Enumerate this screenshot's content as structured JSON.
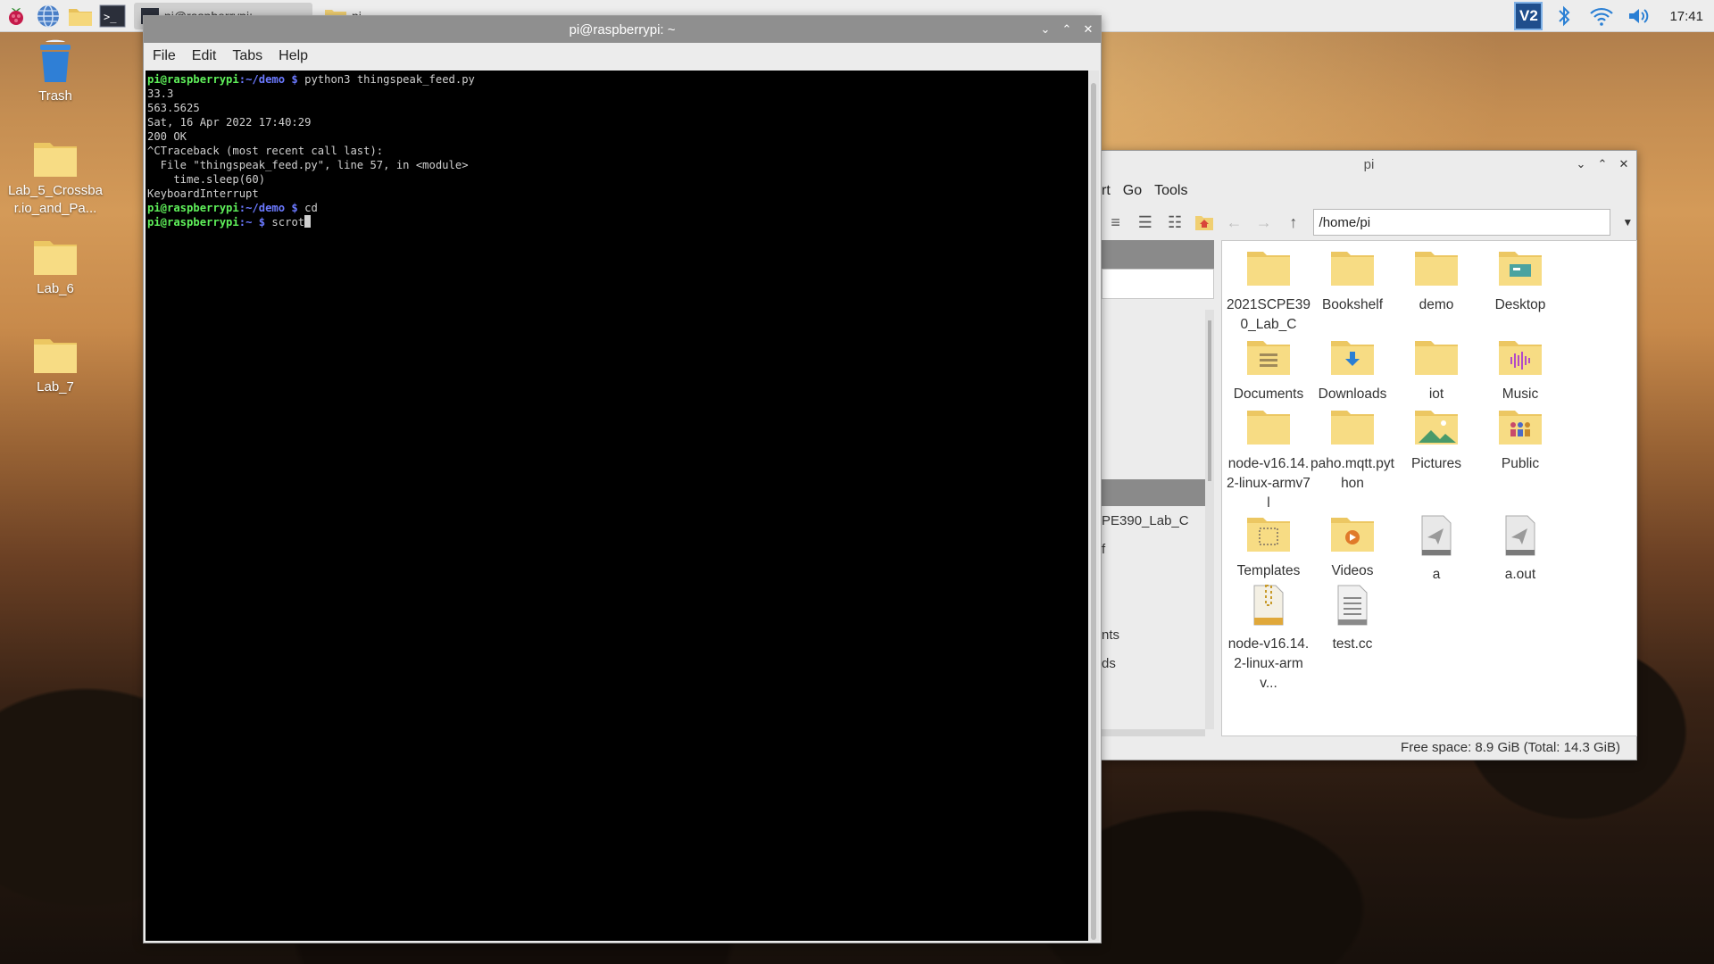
{
  "taskbar": {
    "tasks": [
      {
        "label": "pi@raspberrypi: ~",
        "active": true
      },
      {
        "label": "pi",
        "active": false
      }
    ],
    "tray": {
      "vnc": "V2",
      "clock": "17:41"
    }
  },
  "desktop": {
    "icons": [
      {
        "label": "Trash"
      },
      {
        "label": "Lab_5_Crossbar.io_and_Pa..."
      },
      {
        "label": "Lab_6"
      },
      {
        "label": "Lab_7"
      }
    ]
  },
  "terminal": {
    "title": "pi@raspberrypi: ~",
    "menu": [
      "File",
      "Edit",
      "Tabs",
      "Help"
    ],
    "prompt_user": "pi@raspberrypi",
    "lines": {
      "l1_path": ":~/demo $",
      "l1_cmd": " python3 thingspeak_feed.py",
      "l2": "33.3",
      "l3": "563.5625",
      "l4": "Sat, 16 Apr 2022 17:40:29",
      "l5": "200 OK",
      "l6": "^CTraceback (most recent call last):",
      "l7": "  File \"thingspeak_feed.py\", line 57, in <module>",
      "l8": "    time.sleep(60)",
      "l9": "KeyboardInterrupt",
      "l10_path": ":~/demo $",
      "l10_cmd": " cd",
      "l11_path": ":~ $",
      "l11_cmd": " scrot"
    }
  },
  "filemanager": {
    "title": "pi",
    "menu": [
      "rt",
      "Go",
      "Tools"
    ],
    "path": "/home/pi",
    "side_items": [
      "PE390_Lab_C",
      "f",
      "nts",
      "ds"
    ],
    "items": [
      {
        "label": "2021SCPE390_Lab_C",
        "icon": "folder-icon"
      },
      {
        "label": "Bookshelf",
        "icon": "folder-icon"
      },
      {
        "label": "demo",
        "icon": "folder-icon"
      },
      {
        "label": "Desktop",
        "icon": "desktop-folder-icon"
      },
      {
        "label": "Documents",
        "icon": "documents-folder-icon"
      },
      {
        "label": "Downloads",
        "icon": "downloads-folder-icon"
      },
      {
        "label": "iot",
        "icon": "folder-icon"
      },
      {
        "label": "Music",
        "icon": "music-folder-icon"
      },
      {
        "label": "node-v16.14.2-linux-armv7l",
        "icon": "folder-icon"
      },
      {
        "label": "paho.mqtt.python",
        "icon": "folder-icon"
      },
      {
        "label": "Pictures",
        "icon": "pictures-folder-icon"
      },
      {
        "label": "Public",
        "icon": "public-folder-icon"
      },
      {
        "label": "Templates",
        "icon": "templates-folder-icon"
      },
      {
        "label": "Videos",
        "icon": "videos-folder-icon"
      },
      {
        "label": "a",
        "icon": "executable-icon"
      },
      {
        "label": "a.out",
        "icon": "executable-icon"
      },
      {
        "label": "node-v16.14.2-linux-armv...",
        "icon": "archive-icon"
      },
      {
        "label": "test.cc",
        "icon": "text-file-icon"
      }
    ],
    "status": "Free space: 8.9 GiB (Total: 14.3 GiB)"
  }
}
